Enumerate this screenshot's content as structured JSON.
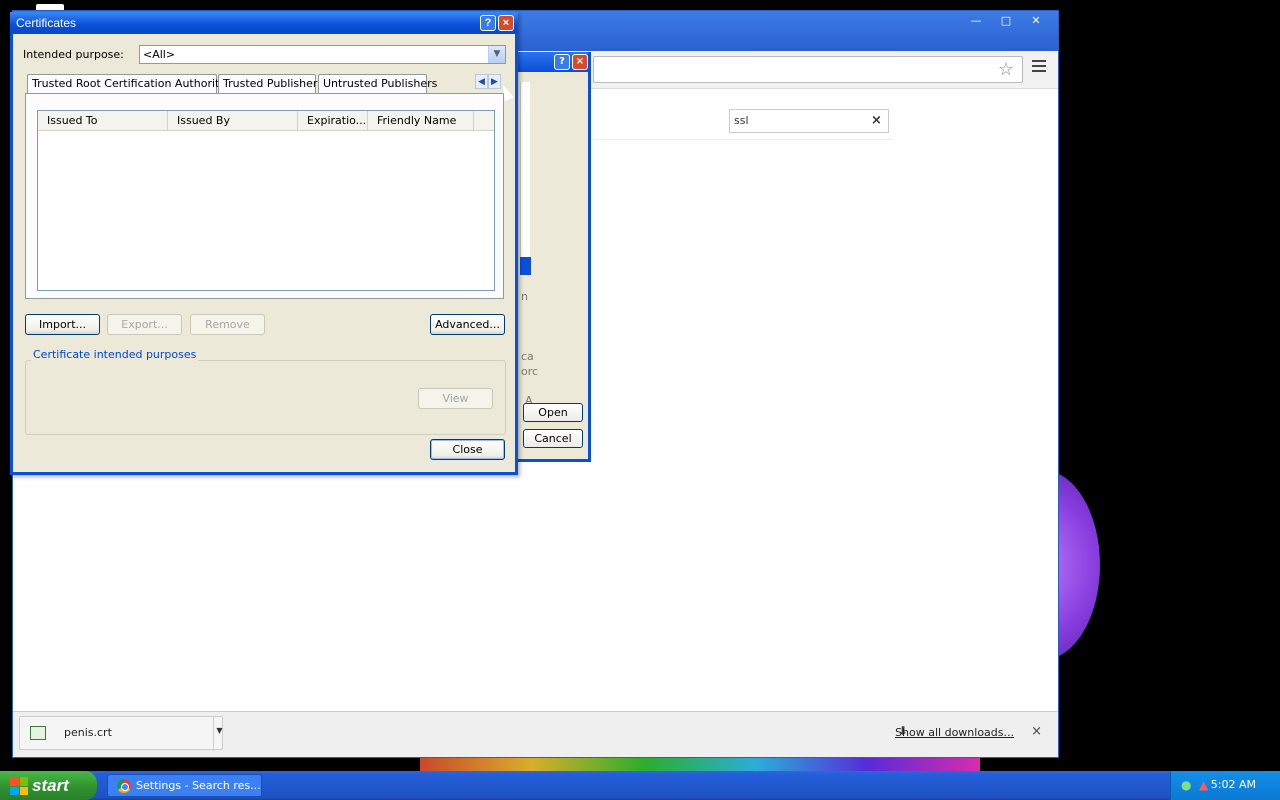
{
  "chrome": {
    "search_value": "ssl",
    "clear_symbol": "×",
    "star_symbol": "☆",
    "downloads": {
      "file_name": "penis.crt",
      "show_all": "Show all downloads...",
      "close_symbol": "×"
    }
  },
  "file_dialog": {
    "help": "?",
    "close": "×",
    "open_label": "Open",
    "cancel_label": "Cancel",
    "partial_text": [
      "n",
      "ca",
      "orc",
      "A"
    ]
  },
  "certificates": {
    "title": "Certificates",
    "help": "?",
    "close": "×",
    "purpose_label": "Intended purpose:",
    "purpose_value": "<All>",
    "tabs": [
      "Trusted Root Certification Authorities",
      "Trusted Publishers",
      "Untrusted Publishers"
    ],
    "columns": [
      "Issued To",
      "Issued By",
      "Expiratio...",
      "Friendly Name"
    ],
    "buttons": {
      "import": "Import...",
      "export": "Export...",
      "remove": "Remove",
      "advanced": "Advanced...",
      "view": "View",
      "close": "Close"
    },
    "group_label": "Certificate intended purposes"
  },
  "taskbar": {
    "start_label": "start",
    "task_item": "Settings - Search res...",
    "clock": "5:02 AM"
  },
  "colors": {
    "xp_blue": "#0a4fd8",
    "dialog_bg": "#ece9d8",
    "start_green": "#2f8f2f"
  }
}
